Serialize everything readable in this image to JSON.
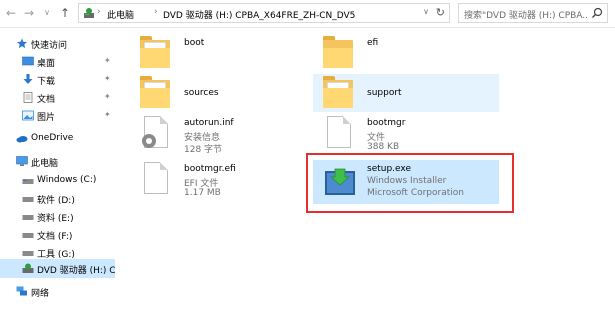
{
  "toolbar": {
    "back": "←",
    "forward": "→",
    "recent": "∨",
    "up": "↑",
    "refresh": "↻",
    "dropdown": "∨"
  },
  "address": {
    "separator": "›",
    "crumbs": [
      "此电脑",
      "DVD 驱动器 (H:) CPBA_X64FRE_ZH-CN_DV5"
    ]
  },
  "search": {
    "placeholder": "搜索\"DVD 驱动器 (H:) CPBA..."
  },
  "sidebar": {
    "items": [
      {
        "label": "快速访问",
        "icon": "star-icon"
      },
      {
        "label": "桌面",
        "icon": "desktop-icon",
        "pinned": true
      },
      {
        "label": "下载",
        "icon": "download-icon",
        "pinned": true
      },
      {
        "label": "文档",
        "icon": "documents-icon",
        "pinned": true
      },
      {
        "label": "图片",
        "icon": "pictures-icon",
        "pinned": true
      },
      {
        "label": "OneDrive",
        "icon": "cloud-icon"
      },
      {
        "label": "此电脑",
        "icon": "computer-icon"
      },
      {
        "label": "Windows (C:)",
        "icon": "drive-icon"
      },
      {
        "label": "软件 (D:)",
        "icon": "drive-icon"
      },
      {
        "label": "资料 (E:)",
        "icon": "drive-icon"
      },
      {
        "label": "文档 (F:)",
        "icon": "drive-icon"
      },
      {
        "label": "工具 (G:)",
        "icon": "drive-icon"
      },
      {
        "label": "DVD 驱动器 (H:) C",
        "icon": "dvd-drive-icon",
        "selected": true
      },
      {
        "label": "网络",
        "icon": "network-icon"
      }
    ],
    "pin_glyph": "✦"
  },
  "files": [
    {
      "name": "boot",
      "type": "folder"
    },
    {
      "name": "efi",
      "type": "folder"
    },
    {
      "name": "sources",
      "type": "folder"
    },
    {
      "name": "support",
      "type": "folder"
    },
    {
      "name": "autorun.inf",
      "type": "file",
      "lines": [
        "安装信息",
        "128 字节"
      ]
    },
    {
      "name": "bootmgr",
      "type": "file",
      "lines": [
        "文件",
        "388 KB"
      ]
    },
    {
      "name": "bootmgr.efi",
      "type": "file",
      "lines": [
        "EFI 文件",
        "1.17 MB"
      ]
    },
    {
      "name": "setup.exe",
      "type": "exe",
      "lines": [
        "Windows Installer",
        "Microsoft Corporation"
      ]
    }
  ],
  "colors": {
    "selection": "#cce8ff",
    "hover": "#e5f3ff",
    "highlight_frame": "#e3302f",
    "folder": "#ffd873"
  }
}
